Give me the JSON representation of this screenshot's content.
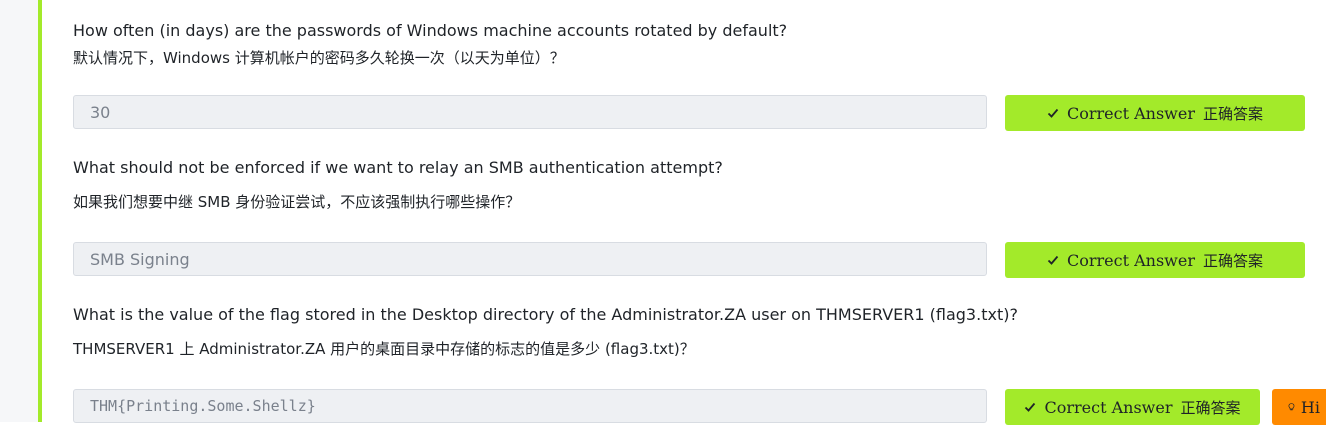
{
  "questions": [
    {
      "question_en": "How often (in days) are the passwords of Windows machine accounts rotated by default?",
      "question_cn": "默认情况下，Windows 计算机帐户的密码多久轮换一次（以天为单位）？",
      "answer": "30",
      "button_label": "Correct Answer",
      "button_label_cn": "正确答案"
    },
    {
      "question_en": "What should not be enforced if we want to relay an SMB authentication attempt?",
      "question_cn": "如果我们想要中继 SMB 身份验证尝试，不应该强制执行哪些操作？",
      "answer": "SMB Signing",
      "button_label": "Correct Answer",
      "button_label_cn": "正确答案"
    },
    {
      "question_en": "What is the value of the flag stored in the Desktop directory of the Administrator.ZA user on THMSERVER1 (flag3.txt)?",
      "question_cn": "THMSERVER1 上 Administrator.ZA 用户的桌面目录中存储的标志的值是多少 (flag3.txt)？",
      "answer": "THM{Printing.Some.Shellz}",
      "button_label": "Correct Answer",
      "button_label_cn": "正确答案",
      "hint_label": "Hi"
    }
  ],
  "icons": {
    "check": "check-icon",
    "hint": "lightbulb-icon"
  },
  "colors": {
    "accent": "#a3ea2a",
    "hint": "#ff8a00",
    "input_bg": "#eef0f3"
  }
}
